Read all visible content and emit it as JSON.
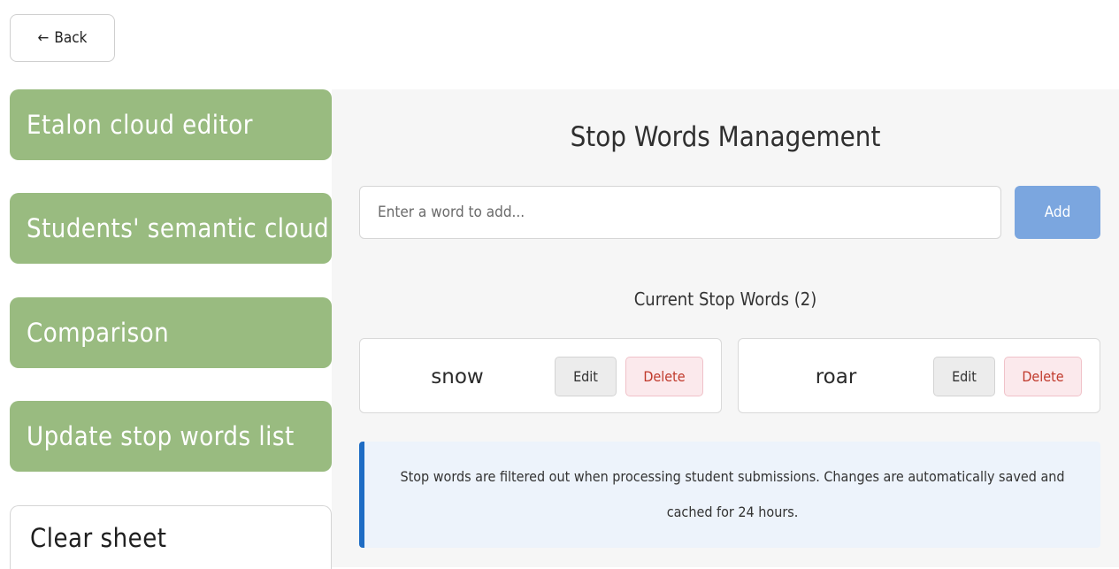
{
  "back": {
    "arrow": "←",
    "label": "Back"
  },
  "sidebar": {
    "items": [
      {
        "label": "Etalon cloud editor"
      },
      {
        "label": "Students' semantic cloud"
      },
      {
        "label": "Comparison"
      },
      {
        "label": "Update stop words list"
      },
      {
        "label": "Clear sheet"
      }
    ]
  },
  "main": {
    "title": "Stop Words Management",
    "input_placeholder": "Enter a word to add...",
    "input_value": "",
    "add_label": "Add",
    "list_title": "Current Stop Words (2)",
    "words": [
      {
        "word": "snow",
        "edit_label": "Edit",
        "delete_label": "Delete"
      },
      {
        "word": "roar",
        "edit_label": "Edit",
        "delete_label": "Delete"
      }
    ],
    "info_text": "Stop words are filtered out when processing student submissions. Changes are automatically saved and cached for 24 hours."
  },
  "colors": {
    "sidebar_green": "#99bb80",
    "add_blue": "#7ba6df",
    "delete_red": "#c0392b",
    "info_border": "#1e6cc4",
    "info_bg": "#edf3fb"
  }
}
